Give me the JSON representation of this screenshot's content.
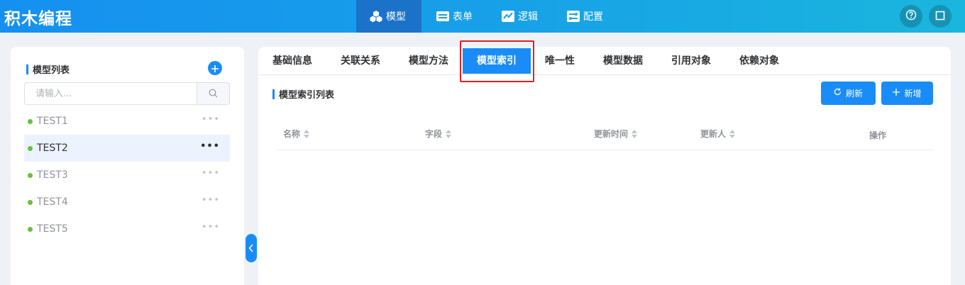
{
  "header": {
    "brand": "积木编程",
    "nav": [
      {
        "label": "模型",
        "icon": "cubes-icon",
        "active": true
      },
      {
        "label": "表单",
        "icon": "form-icon",
        "active": false
      },
      {
        "label": "逻辑",
        "icon": "logic-icon",
        "active": false
      },
      {
        "label": "配置",
        "icon": "config-icon",
        "active": false
      }
    ],
    "actions": [
      "help-icon",
      "fullscreen-icon"
    ]
  },
  "sidebar": {
    "title": "模型列表",
    "search_placeholder": "请输入...",
    "items": [
      {
        "label": "TEST1",
        "selected": false,
        "status_color": "#67c23a"
      },
      {
        "label": "TEST2",
        "selected": true,
        "status_color": "#67c23a"
      },
      {
        "label": "TEST3",
        "selected": false,
        "status_color": "#67c23a"
      },
      {
        "label": "TEST4",
        "selected": false,
        "status_color": "#67c23a"
      },
      {
        "label": "TEST5",
        "selected": false,
        "status_color": "#67c23a"
      }
    ],
    "more_label": "•••"
  },
  "tabs": [
    "基础信息",
    "关联关系",
    "模型方法",
    "模型索引",
    "唯一性",
    "模型数据",
    "引用对象",
    "依赖对象"
  ],
  "active_tab": "模型索引",
  "main": {
    "section_title": "模型索引列表",
    "refresh_label": "刷新",
    "add_label": "新增",
    "columns": [
      "名称",
      "字段",
      "更新时间",
      "更新人",
      "操作"
    ],
    "rows": []
  },
  "colors": {
    "accent": "#1a8cf7",
    "highlight": "#e02020",
    "status_ok": "#67c23a"
  }
}
